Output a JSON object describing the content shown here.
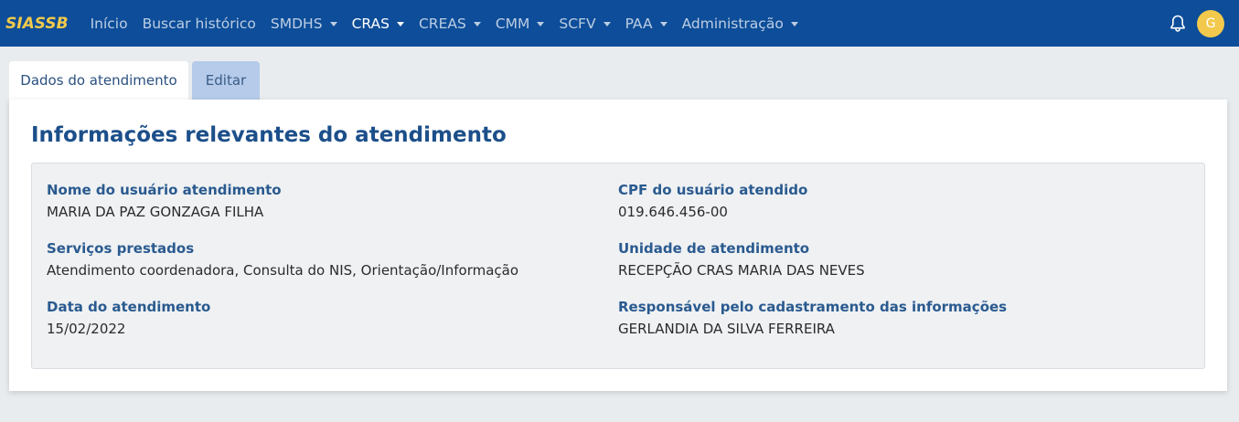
{
  "navbar": {
    "brand": "SIASSB",
    "items": [
      {
        "label": "Início",
        "dropdown": false,
        "active": false
      },
      {
        "label": "Buscar histórico",
        "dropdown": false,
        "active": false
      },
      {
        "label": "SMDHS",
        "dropdown": true,
        "active": false
      },
      {
        "label": "CRAS",
        "dropdown": true,
        "active": true
      },
      {
        "label": "CREAS",
        "dropdown": true,
        "active": false
      },
      {
        "label": "CMM",
        "dropdown": true,
        "active": false
      },
      {
        "label": "SCFV",
        "dropdown": true,
        "active": false
      },
      {
        "label": "PAA",
        "dropdown": true,
        "active": false
      },
      {
        "label": "Administração",
        "dropdown": true,
        "active": false
      }
    ],
    "notification_icon": "bell-icon",
    "avatar_initial": "G"
  },
  "tabs": [
    {
      "label": "Dados do atendimento",
      "active": true
    },
    {
      "label": "Editar",
      "active": false
    }
  ],
  "card": {
    "title": "Informações relevantes do atendimento",
    "fields": {
      "nome": {
        "label": "Nome do usuário atendimento",
        "value": "MARIA DA PAZ GONZAGA FILHA"
      },
      "cpf": {
        "label": "CPF do usuário atendido",
        "value": "019.646.456-00"
      },
      "servicos": {
        "label": "Serviços prestados",
        "value": "Atendimento coordenadora, Consulta do NIS, Orientação/Informação"
      },
      "unidade": {
        "label": "Unidade de atendimento",
        "value": "RECEPÇÃO CRAS MARIA DAS NEVES"
      },
      "data": {
        "label": "Data do atendimento",
        "value": "15/02/2022"
      },
      "responsavel": {
        "label": "Responsável pelo cadastramento das informações",
        "value": "GERLANDIA DA SILVA FERREIRA"
      }
    }
  },
  "colors": {
    "navbar_bg": "#0d4d99",
    "brand": "#f2c94c",
    "avatar_bg": "#f2c94c",
    "title": "#1c4f8a",
    "page_bg": "#e9ecef"
  }
}
